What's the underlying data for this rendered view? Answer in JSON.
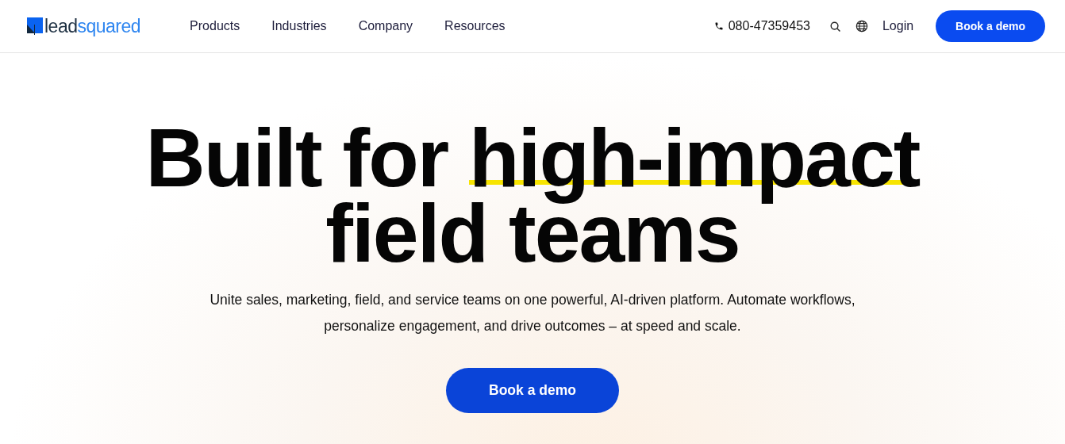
{
  "header": {
    "logo": {
      "part_1": "lead",
      "part_2": "squared"
    },
    "nav": [
      "Products",
      "Industries",
      "Company",
      "Resources"
    ],
    "phone": "080-47359453",
    "login": "Login",
    "cta": "Book a demo"
  },
  "hero": {
    "headline": {
      "before": "Built for ",
      "highlight": "high-impact",
      "after": " field teams"
    },
    "subtitle": "Unite sales, marketing, field, and service teams on one powerful, AI-driven platform. Automate workflows, personalize engagement, and drive outcomes – at speed and scale.",
    "cta": "Book a demo"
  }
}
